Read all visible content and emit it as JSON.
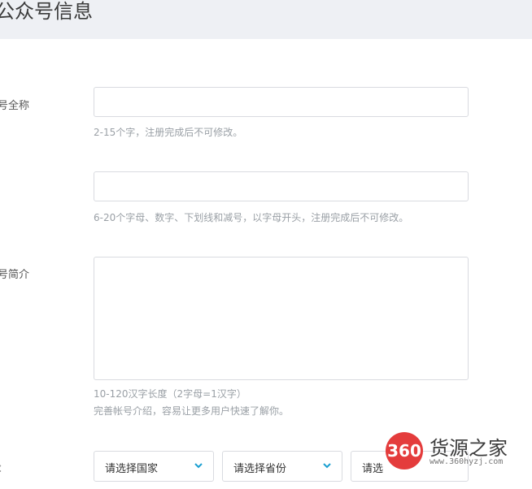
{
  "header": {
    "title": "公众号信息"
  },
  "fields": {
    "name_label": "号全称",
    "name_hint": "2-15个字，注册完成后不可修改。",
    "id_hint": "6-20个字母、数字、下划线和减号，以字母开头，注册完成后不可修改。",
    "intro_label": "号简介",
    "intro_hint_1": "10-120汉字长度（2字母=1汉字）",
    "intro_hint_2": "完善帐号介绍，容易让更多用户快速了解你。",
    "region_label": "："
  },
  "selects": {
    "country": "请选择国家",
    "province": "请选择省份",
    "city": "请选"
  },
  "icons": {
    "chevron": "chevron-down-icon"
  },
  "colors": {
    "header_bg": "#eef0f4",
    "chevron": "#1a9fd1",
    "watermark_badge": "#e43c3c"
  },
  "watermark": {
    "badge_text": "360",
    "title": "货源之家",
    "url": "www.360hyzj.com"
  }
}
